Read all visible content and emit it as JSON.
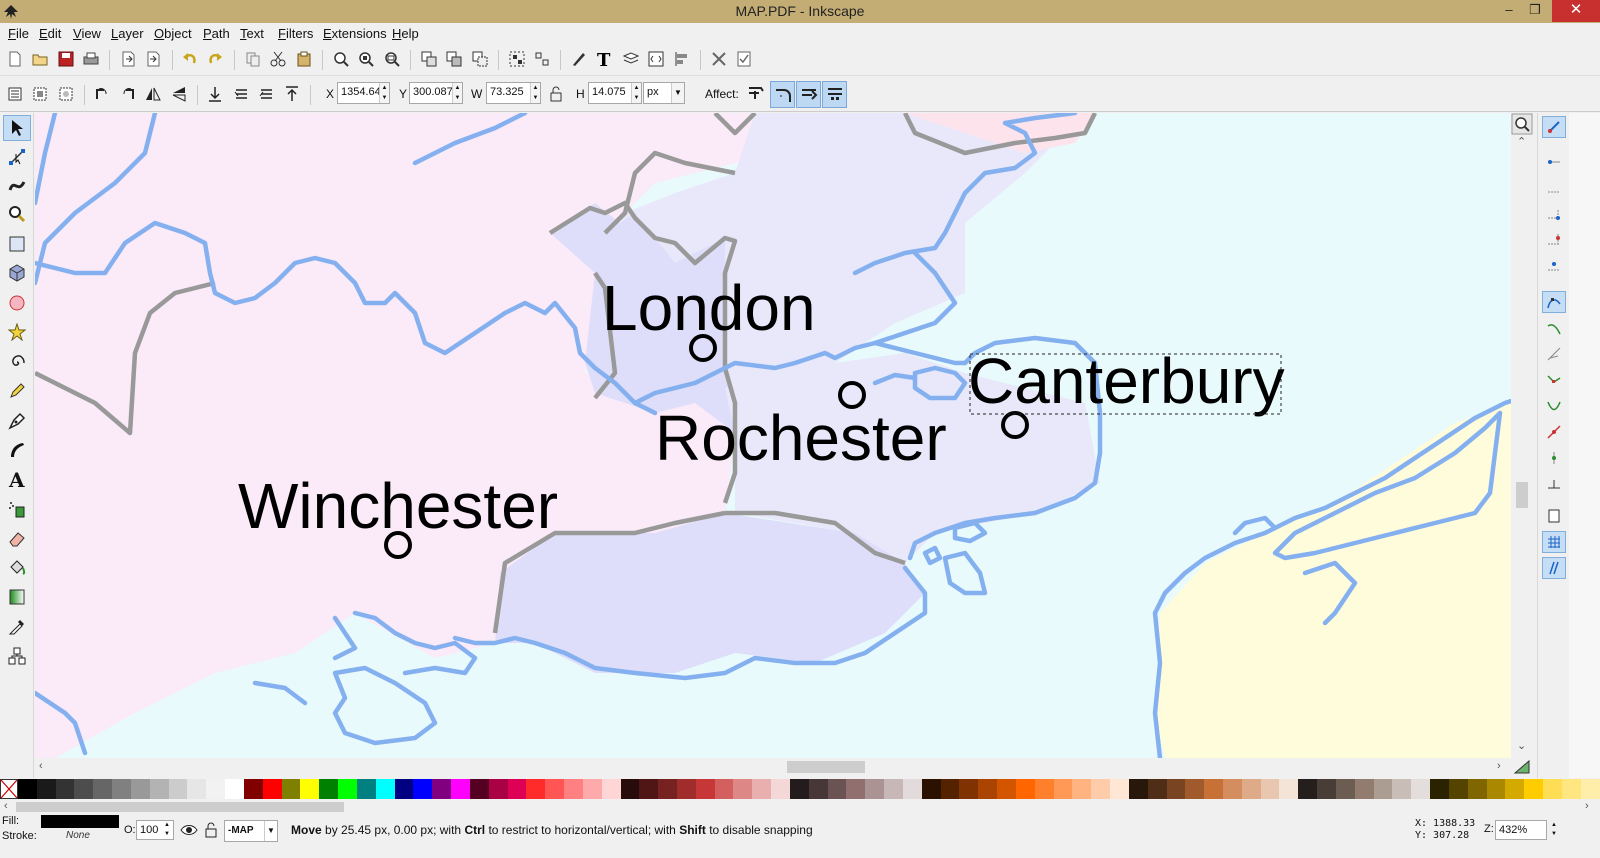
{
  "window": {
    "title": "MAP.PDF - Inkscape",
    "min": "–",
    "max": "❐",
    "close": "✕"
  },
  "menu": [
    "File",
    "Edit",
    "View",
    "Layer",
    "Object",
    "Path",
    "Text",
    "Filters",
    "Extensions",
    "Help"
  ],
  "controls": {
    "x_label": "X",
    "x_value": "1354.64",
    "y_label": "Y",
    "y_value": "300.087",
    "w_label": "W",
    "w_value": "73.325",
    "h_label": "H",
    "h_value": "14.075",
    "unit": "px",
    "affect_label": "Affect:"
  },
  "map_labels": {
    "london": "London",
    "rochester": "Rochester",
    "canterbury": "Canterbury",
    "winchester": "Winchester"
  },
  "status": {
    "fill_label": "Fill:",
    "stroke_label": "Stroke:",
    "stroke_value": "None",
    "opacity_label": "O:",
    "opacity_value": "100",
    "layer": "-MAP",
    "msg_move": "Move",
    "msg_by": " by 25.45 px, 0.00 px; with ",
    "msg_ctrl": "Ctrl",
    "msg_mid": " to restrict to horizontal/vertical; with ",
    "msg_shift": "Shift",
    "msg_end": " to disable snapping",
    "x_coord": "X: 1388.33",
    "y_coord": "Y:  307.28",
    "zoom_label": "Z:",
    "zoom_value": "432%"
  },
  "colors": {
    "titlebar": "#c3ad74",
    "sea": "#e9fafc",
    "region_pink": "#fbeaf8",
    "region_lavender": "#e8e8fa",
    "region_purple": "#dedefa",
    "region_yellow": "#fffcdc",
    "coast": "#84b0f0",
    "border": "#999999"
  },
  "palette": [
    "#000000",
    "#1a1a1a",
    "#333333",
    "#4d4d4d",
    "#666666",
    "#808080",
    "#999999",
    "#b3b3b3",
    "#cccccc",
    "#e6e6e6",
    "#f2f2f2",
    "#ffffff",
    "#800000",
    "#ff0000",
    "#808000",
    "#ffff00",
    "#008000",
    "#00ff00",
    "#008080",
    "#00ffff",
    "#000080",
    "#0000ff",
    "#800080",
    "#ff00ff",
    "#550022",
    "#aa0044",
    "#dd0055",
    "#ff2a2a",
    "#ff5555",
    "#ff8080",
    "#ffaaaa",
    "#ffd5d5",
    "#280b0b",
    "#501616",
    "#782121",
    "#a02c2c",
    "#c83737",
    "#d35f5f",
    "#de8787",
    "#e9afaf",
    "#f4d7d7",
    "#241c1c",
    "#483737",
    "#6c5353",
    "#916f6f",
    "#ac9393",
    "#c8b7b7",
    "#e3dbdb",
    "#2b1100",
    "#552200",
    "#803300",
    "#aa4400",
    "#d45500",
    "#ff6600",
    "#ff7f2a",
    "#ff9955",
    "#ffb380",
    "#ffccaa",
    "#ffe6d5",
    "#28170b",
    "#502d16",
    "#784421",
    "#a05a2c",
    "#c87137",
    "#d38d5f",
    "#deaa87",
    "#e9c6af",
    "#f4e3d7",
    "#241f1c",
    "#483e37",
    "#6c5d53",
    "#917c6f",
    "#ac9d93",
    "#c8beb7",
    "#e3dedb",
    "#2b2200",
    "#554400",
    "#806600",
    "#aa8800",
    "#d4aa00",
    "#ffcc00",
    "#ffdd55",
    "#ffe680",
    "#ffeeaa"
  ]
}
